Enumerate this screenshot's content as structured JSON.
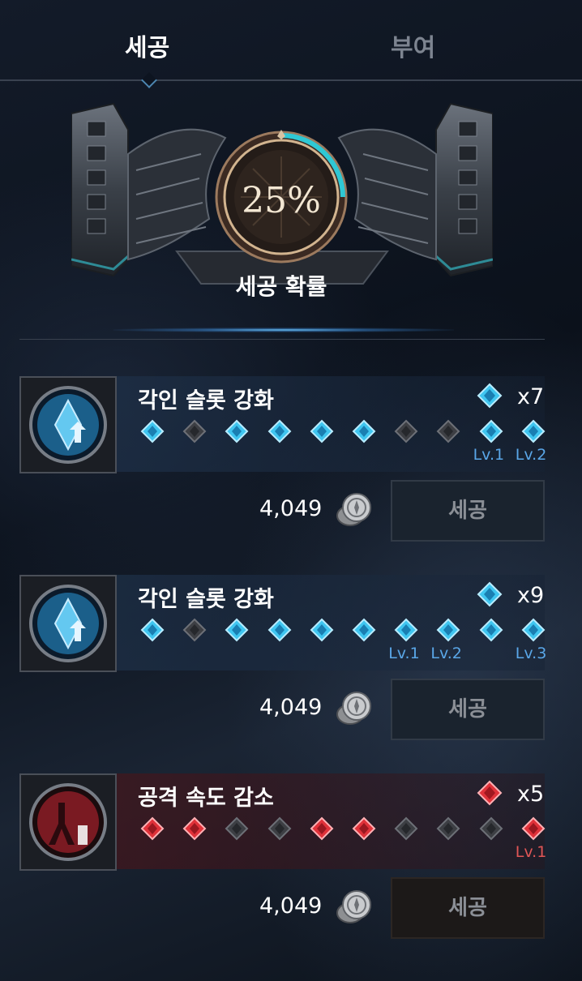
{
  "tabs": [
    {
      "label": "세공",
      "active": true
    },
    {
      "label": "부여",
      "active": false
    }
  ],
  "success": {
    "percent": "25%",
    "value": 0.25,
    "label": "세공 확률",
    "accent_color": "#2fc8d4"
  },
  "cards": [
    {
      "title": "각인 슬롯 강화",
      "theme": "blue",
      "gem_icon": "blue-gem-icon",
      "count": "x7",
      "slots": [
        "blue",
        "gray",
        "blue",
        "blue",
        "blue",
        "blue",
        "gray",
        "gray",
        "blue",
        "blue"
      ],
      "level_labels": [
        {
          "slot": 8,
          "text": "Lv.1"
        },
        {
          "slot": 9,
          "text": "Lv.2"
        }
      ],
      "price": "4,049",
      "button_label": "세공"
    },
    {
      "title": "각인 슬롯 강화",
      "theme": "blue",
      "gem_icon": "blue-gem-icon",
      "count": "x9",
      "slots": [
        "blue",
        "gray",
        "blue",
        "blue",
        "blue",
        "blue",
        "blue",
        "blue",
        "blue",
        "blue"
      ],
      "level_labels": [
        {
          "slot": 6,
          "text": "Lv.1"
        },
        {
          "slot": 7,
          "text": "Lv.2"
        },
        {
          "slot": 9,
          "text": "Lv.3"
        }
      ],
      "price": "4,049",
      "button_label": "세공"
    },
    {
      "title": "공격 속도 감소",
      "theme": "red",
      "gem_icon": "red-gem-icon",
      "count": "x5",
      "slots": [
        "red",
        "red",
        "gray",
        "gray",
        "red",
        "red",
        "gray",
        "gray",
        "gray",
        "red"
      ],
      "level_labels": [
        {
          "slot": 9,
          "text": "Lv.1"
        }
      ],
      "price": "4,049",
      "button_label": "세공"
    }
  ],
  "colors": {
    "blue_gem": "#3fc6f0",
    "red_gem": "#e0323a",
    "gray_gem": "#3d3f44",
    "level_blue": "#5aa7e8",
    "level_red": "#e05656"
  }
}
